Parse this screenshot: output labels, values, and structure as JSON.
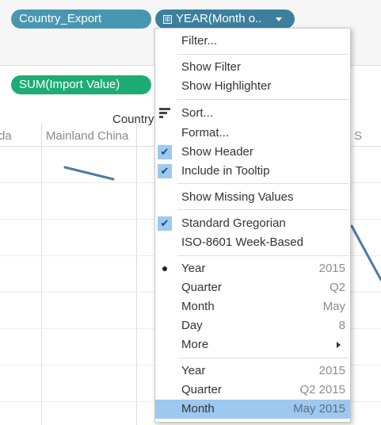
{
  "shelves": {
    "columns_pills": [
      "Country_Export",
      "YEAR(Month o.."
    ],
    "rows_pills": [
      "SUM(Import Value)"
    ],
    "expand_glyph": "⊞"
  },
  "view": {
    "header_title": "Country",
    "column_headers": [
      "da",
      "Mainland China",
      "ted S"
    ],
    "line_color": "#4e79a7"
  },
  "menu": {
    "items": {
      "filter": "Filter...",
      "show_filter": "Show Filter",
      "show_highlighter": "Show Highlighter",
      "sort": "Sort...",
      "format": "Format...",
      "show_header": "Show Header",
      "include_tooltip": "Include in Tooltip",
      "show_missing": "Show Missing Values",
      "standard_gregorian": "Standard Gregorian",
      "iso_week": "ISO-8601 Week-Based",
      "year": "Year",
      "quarter": "Quarter",
      "month": "Month",
      "day": "Day",
      "more": "More",
      "year2": "Year",
      "quarter2": "Quarter",
      "month2": "Month"
    },
    "values": {
      "year": "2015",
      "quarter": "Q2",
      "month": "May",
      "day": "8",
      "year2": "2015",
      "quarter2": "Q2 2015",
      "month2": "May 2015"
    },
    "check_glyph": "✔",
    "checked": [
      "show_header",
      "include_tooltip",
      "standard_gregorian"
    ],
    "radio_selected": "year",
    "highlighted": "month2",
    "highlight_color": "#9dc8ef"
  }
}
